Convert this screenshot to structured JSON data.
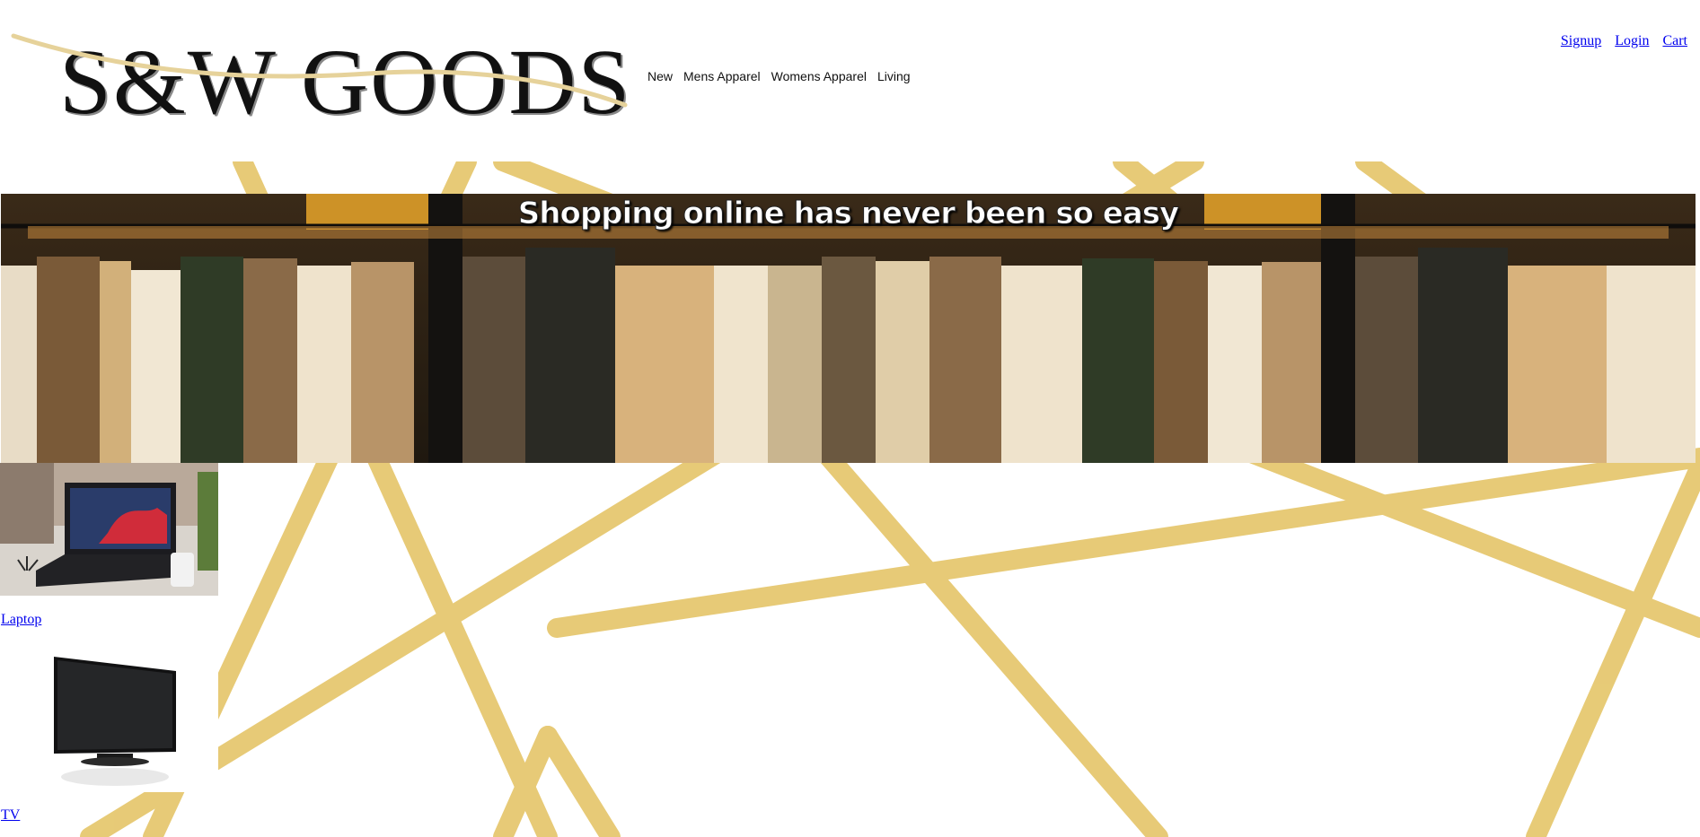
{
  "brand": {
    "logo_text": "S&W GOODS"
  },
  "nav": {
    "items": [
      {
        "label": "New"
      },
      {
        "label": "Mens Apparel"
      },
      {
        "label": "Womens Apparel"
      },
      {
        "label": "Living"
      }
    ]
  },
  "account": {
    "signup": "Signup",
    "login": "Login",
    "cart": "Cart"
  },
  "hero": {
    "title": "Shopping online has never been so easy"
  },
  "products": [
    {
      "name": "Laptop"
    },
    {
      "name": "TV"
    }
  ],
  "colors": {
    "gold_lines": "#e6c870",
    "link": "#0000ee"
  }
}
